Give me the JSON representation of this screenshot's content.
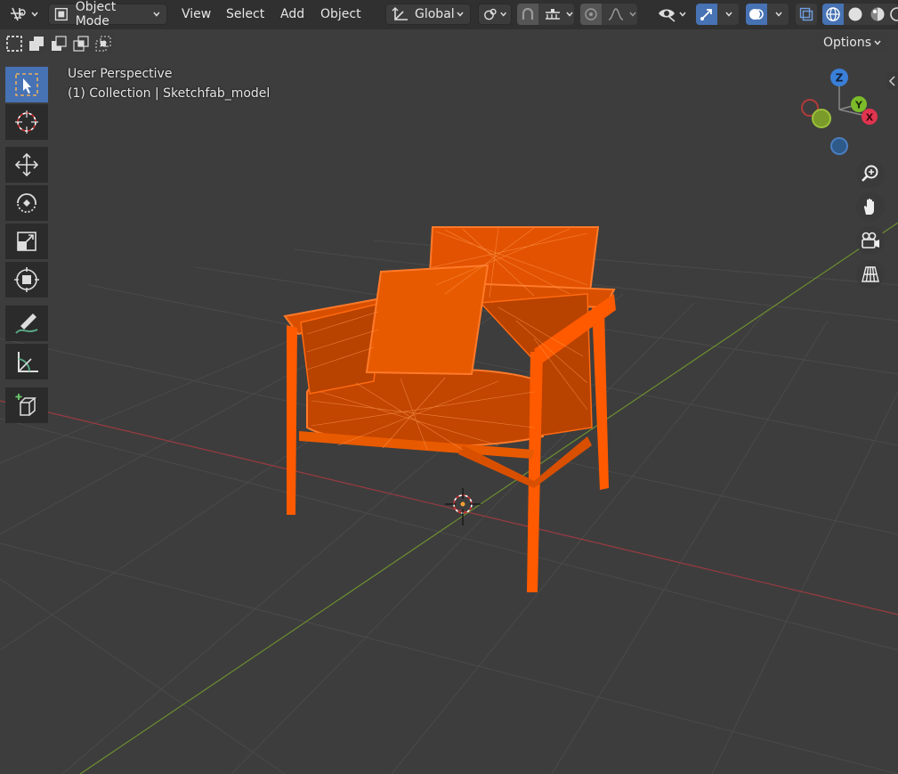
{
  "header": {
    "mode_label": "Object Mode",
    "menus": [
      "View",
      "Select",
      "Add",
      "Object"
    ],
    "transform_orientation": "Global",
    "options_label": "Options"
  },
  "viewport": {
    "view_name": "User Perspective",
    "collection_info": "(1) Collection | Sketchfab_model"
  },
  "gizmo": {
    "x_label": "X",
    "y_label": "Y",
    "z_label": "Z"
  },
  "colors": {
    "header_bg": "#303030",
    "viewport_bg": "#3d3d3d",
    "active_blue": "#4772b3",
    "wireframe_orange": "#ff5a00",
    "x_axis_red": "#c0393f",
    "y_axis_green": "#7aa12b"
  },
  "icons": [
    "editor-type-icon",
    "object-mode-icon",
    "transform-orientation-icon",
    "pivot-icon",
    "snap-icon",
    "snap-increment-icon",
    "proportional-edit-icon",
    "falloff-icon",
    "visibility-icon",
    "gizmo-icon",
    "overlay-icon",
    "xray-icon",
    "wireframe-shading-icon",
    "solid-shading-icon",
    "material-shading-icon",
    "rendered-shading-icon",
    "select-box-icon",
    "cursor-icon",
    "move-icon",
    "rotate-icon",
    "scale-icon",
    "transform-icon",
    "annotate-icon",
    "measure-icon",
    "add-cube-icon",
    "zoom-icon",
    "hand-pan-icon",
    "camera-icon",
    "grid-perspective-icon"
  ]
}
